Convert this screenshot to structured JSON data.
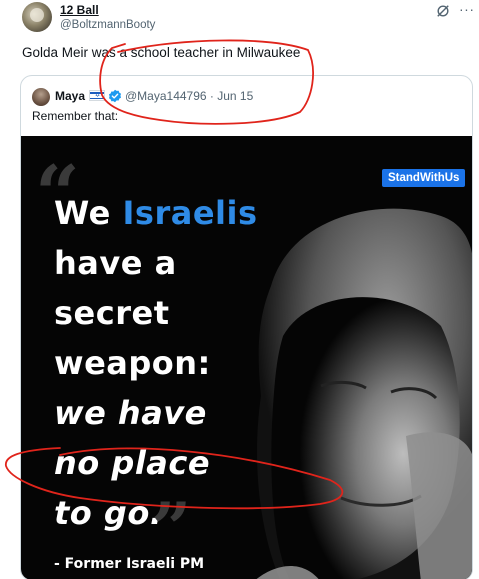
{
  "tweet": {
    "display_name": "12 Ball",
    "handle": "@BoltzmannBooty",
    "text": "Golda Meir was a school teacher in Milwaukee",
    "more_glyph": "···"
  },
  "quoted": {
    "display_name": "Maya",
    "handle_time": "@Maya144796 · Jun 15",
    "text": "Remember that:",
    "image": {
      "badge": "StandWithUs",
      "open_quote": "“",
      "close_quote": "”",
      "lines": [
        {
          "pre": "We ",
          "highlight": "Israelis",
          "post": ""
        },
        {
          "pre": "have a",
          "highlight": "",
          "post": ""
        },
        {
          "pre": "secret",
          "highlight": "",
          "post": ""
        },
        {
          "pre": "weapon:",
          "highlight": "",
          "post": ""
        },
        {
          "pre": "we have",
          "highlight": "",
          "post": ""
        },
        {
          "pre": "no place",
          "highlight": "",
          "post": ""
        },
        {
          "pre": "to go.",
          "highlight": "",
          "post": ""
        }
      ],
      "attribution": "- Former Israeli PM"
    }
  },
  "colors": {
    "accent_blue": "#2f8be6",
    "badge_blue": "#1b73e8",
    "verified_blue": "#1d9bf0",
    "scribble_red": "#e0241b"
  },
  "icons": {
    "grok": "grok-icon",
    "more": "more-icon",
    "verified": "verified-icon",
    "flag": "israel-flag-icon"
  }
}
